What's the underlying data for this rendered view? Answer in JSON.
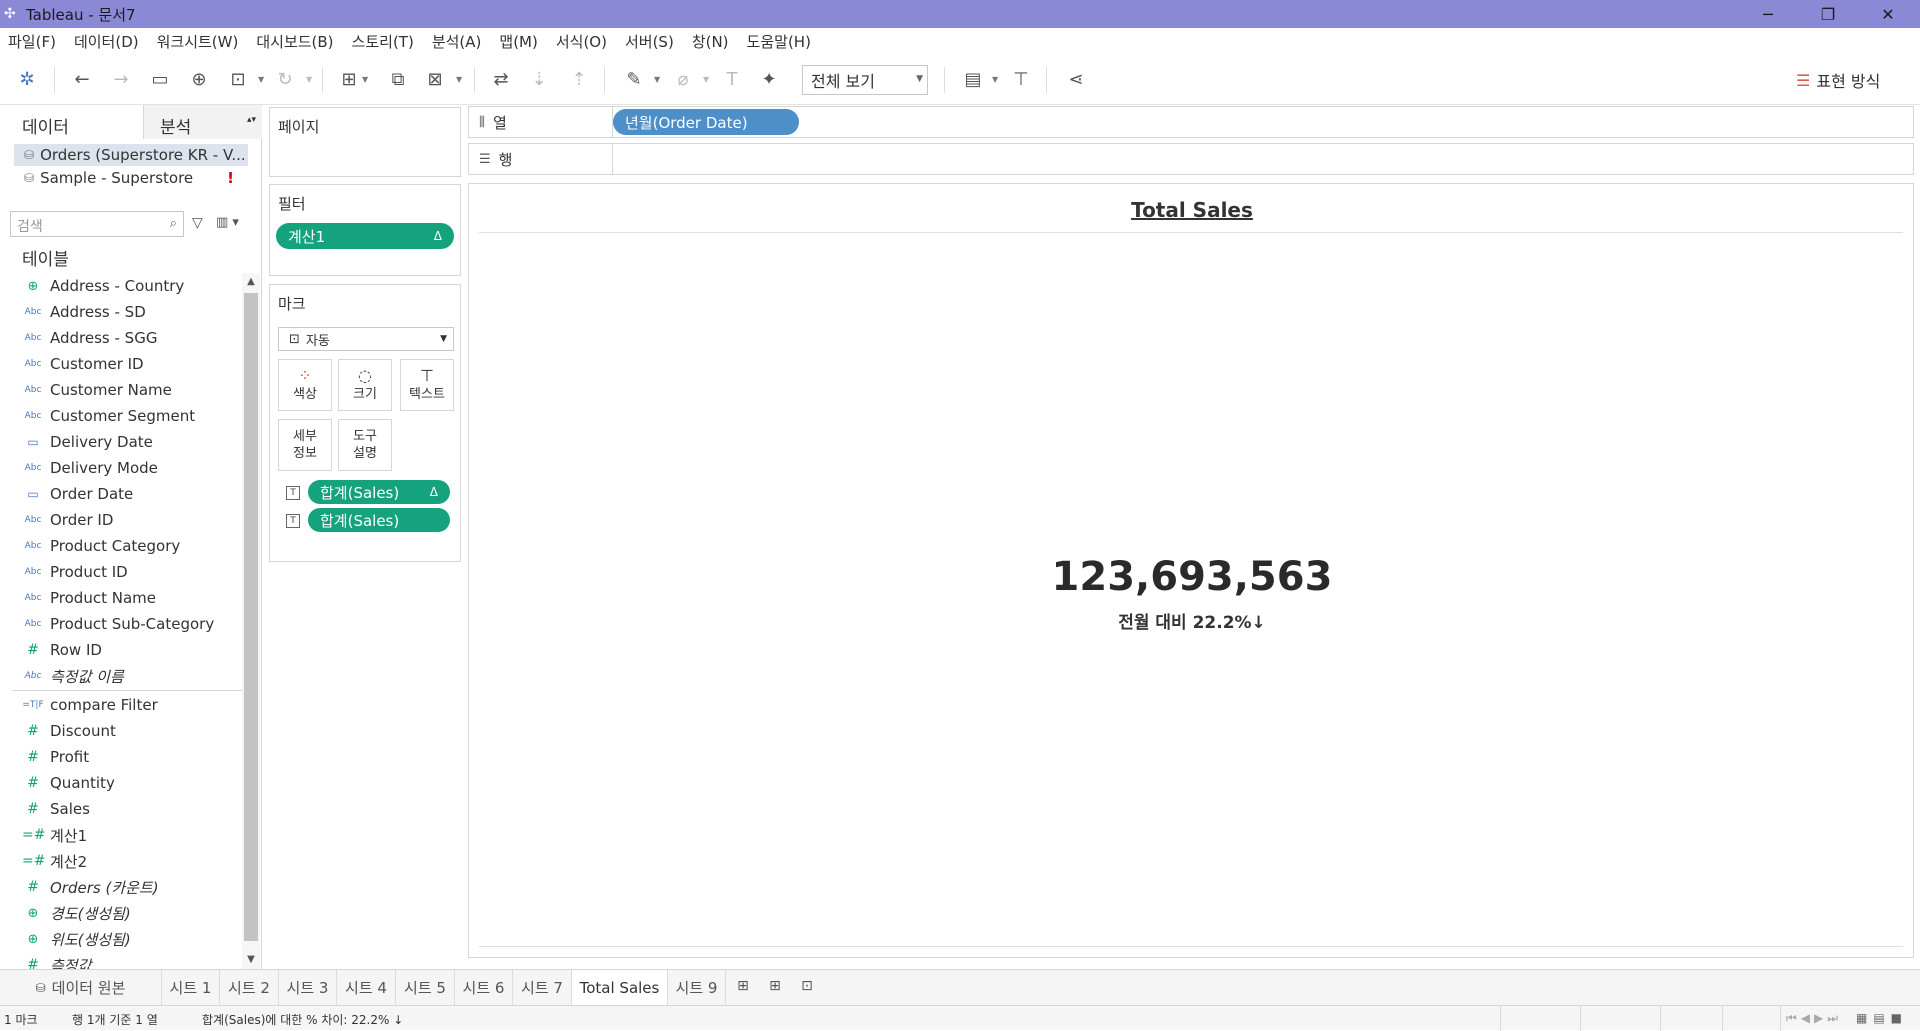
{
  "window": {
    "title": "Tableau - 문서7",
    "minimize": "─",
    "restore": "❐",
    "close": "✕"
  },
  "menu": [
    "파일(F)",
    "데이터(D)",
    "워크시트(W)",
    "대시보드(B)",
    "스토리(T)",
    "분석(A)",
    "맵(M)",
    "서식(O)",
    "서버(S)",
    "창(N)",
    "도움말(H)"
  ],
  "toolbar": {
    "view_option": "전체 보기",
    "show_me": "표현 방식"
  },
  "datapane": {
    "tab_data": "데이터",
    "tab_analysis": "분석",
    "sources": [
      "Orders (Superstore KR - V...",
      "Sample - Superstore"
    ],
    "source_warning": "!",
    "search_placeholder": "검색",
    "tables_heading": "테이블",
    "dimensions": [
      {
        "type": "geo",
        "label": "Address - Country"
      },
      {
        "type": "abc",
        "label": "Address - SD"
      },
      {
        "type": "abc",
        "label": "Address - SGG"
      },
      {
        "type": "abc",
        "label": "Customer ID"
      },
      {
        "type": "abc",
        "label": "Customer Name"
      },
      {
        "type": "abc",
        "label": "Customer Segment"
      },
      {
        "type": "cal",
        "label": "Delivery Date"
      },
      {
        "type": "abc",
        "label": "Delivery Mode"
      },
      {
        "type": "cal",
        "label": "Order Date"
      },
      {
        "type": "abc",
        "label": "Order ID"
      },
      {
        "type": "abc",
        "label": "Product Category"
      },
      {
        "type": "abc",
        "label": "Product ID"
      },
      {
        "type": "abc",
        "label": "Product Name"
      },
      {
        "type": "abc",
        "label": "Product Sub-Category"
      },
      {
        "type": "hash",
        "label": "Row ID"
      },
      {
        "type": "abc",
        "label": "측정값 이름",
        "italic": true
      }
    ],
    "measures": [
      {
        "type": "bool",
        "label": "compare Filter"
      },
      {
        "type": "hash",
        "label": "Discount"
      },
      {
        "type": "hash",
        "label": "Profit"
      },
      {
        "type": "hash",
        "label": "Quantity"
      },
      {
        "type": "hash",
        "label": "Sales"
      },
      {
        "type": "calc",
        "label": "계산1"
      },
      {
        "type": "calc",
        "label": "계산2"
      },
      {
        "type": "hash",
        "label": "Orders (카운트)",
        "italic": true
      },
      {
        "type": "geo",
        "label": "경도(생성됨)",
        "italic": true
      },
      {
        "type": "geo",
        "label": "위도(생성됨)",
        "italic": true
      },
      {
        "type": "hash",
        "label": "측정값",
        "italic": true
      }
    ]
  },
  "cards": {
    "pages": "페이지",
    "filters": "필터",
    "filter_pill": "계산1",
    "marks": "마크",
    "mark_type": "자동",
    "buttons": {
      "color": "색상",
      "size": "크기",
      "text": "텍스트",
      "detail": "세부\n정보",
      "tooltip": "도구\n설명"
    },
    "encodings": [
      "합계(Sales)",
      "합계(Sales)"
    ],
    "delta": "Δ"
  },
  "shelves": {
    "columns_label": "열",
    "rows_label": "행",
    "column_pill": "년월(Order Date)"
  },
  "view": {
    "title": "Total Sales",
    "big_number": "123,693,563",
    "compare": "전월 대비 22.2%↓"
  },
  "sheet_tabs": {
    "datasource": "데이터 원본",
    "sheets": [
      "시트 1",
      "시트 2",
      "시트 3",
      "시트 4",
      "시트 5",
      "시트 6",
      "시트 7",
      "Total Sales",
      "시트 9"
    ],
    "active": "Total Sales"
  },
  "status": {
    "marks": "1 마크",
    "rows_cols": "행 1개 기준 1 열",
    "diff": "합계(Sales)에 대한 % 차이:  22.2% ↓"
  }
}
